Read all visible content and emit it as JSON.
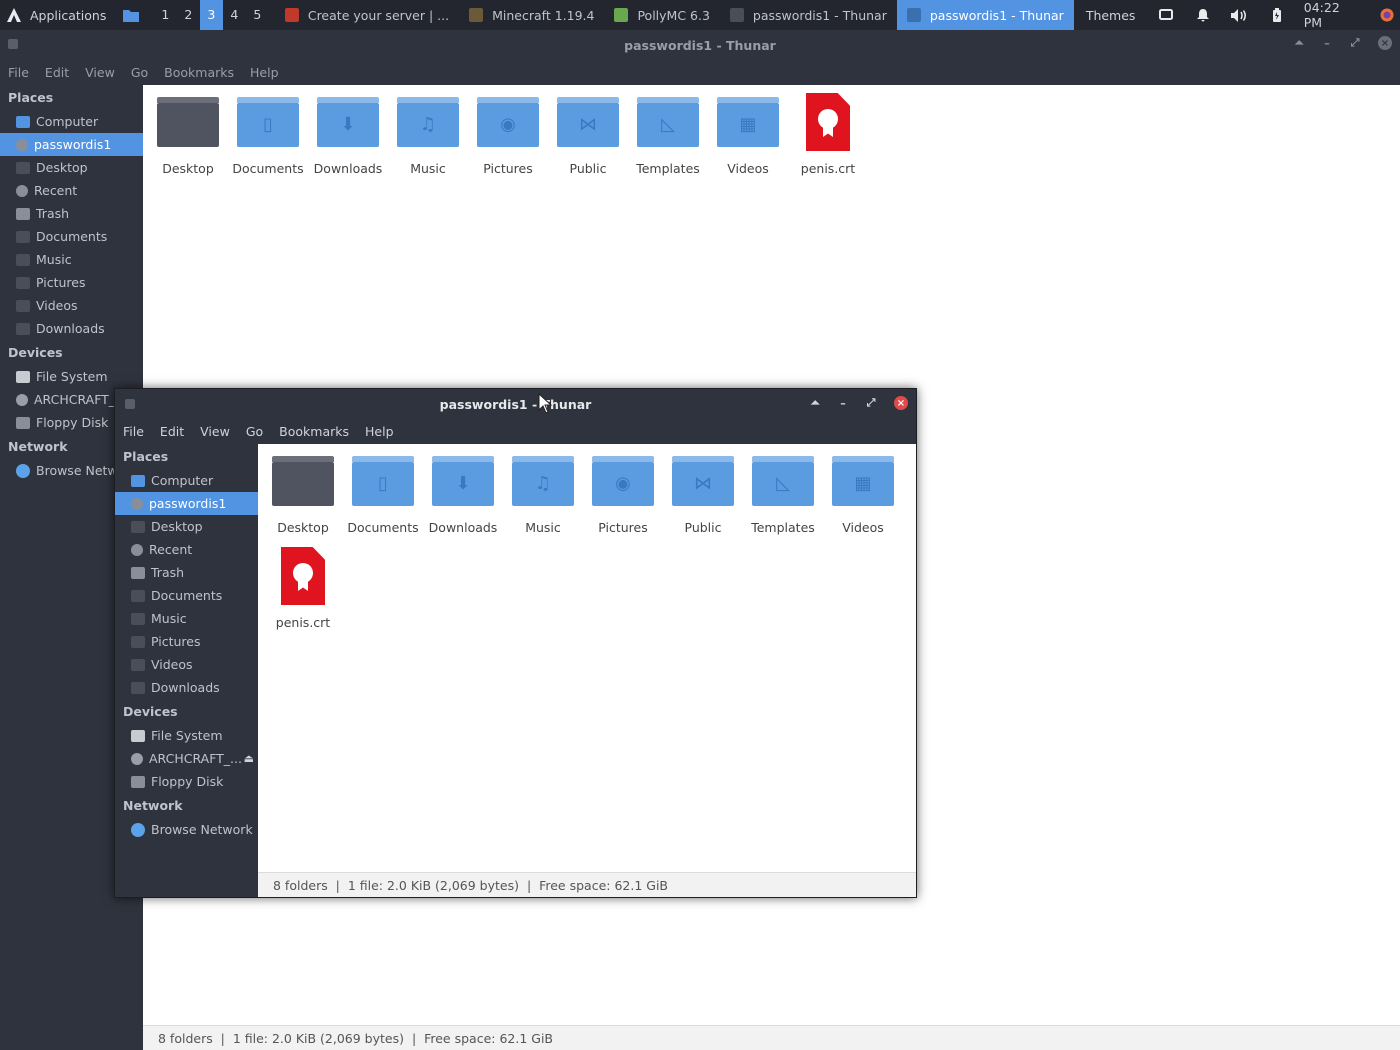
{
  "panel": {
    "app_menu_label": "Applications",
    "workspaces": [
      "1",
      "2",
      "3",
      "4",
      "5"
    ],
    "active_workspace": "3",
    "tasks": [
      {
        "label": "Create your server | ...",
        "icon": "browser-icon",
        "color": "#c0392b",
        "active": false
      },
      {
        "label": "Minecraft 1.19.4",
        "icon": "minecraft-icon",
        "color": "#6b5a3a",
        "active": false
      },
      {
        "label": "PollyMC 6.3",
        "icon": "pollymc-icon",
        "color": "#6aa84f",
        "active": false
      },
      {
        "label": "passwordis1 - Thunar",
        "icon": "thunar-icon",
        "color": "#4a4e58",
        "active": false
      },
      {
        "label": "passwordis1 - Thunar",
        "icon": "thunar-icon",
        "color": "#3a6fb0",
        "active": true
      }
    ],
    "themes_label": "Themes",
    "clock": "04:22 PM"
  },
  "window": {
    "title": "passwordis1 - Thunar",
    "menu": [
      "File",
      "Edit",
      "View",
      "Go",
      "Bookmarks",
      "Help"
    ]
  },
  "sidebar": {
    "places_header": "Places",
    "places": [
      {
        "label": "Computer",
        "icon": "computer-icon",
        "selected": false
      },
      {
        "label": "passwordis1",
        "icon": "home-icon",
        "selected": true
      },
      {
        "label": "Desktop",
        "icon": "desktop-icon",
        "selected": false
      },
      {
        "label": "Recent",
        "icon": "recent-icon",
        "selected": false
      },
      {
        "label": "Trash",
        "icon": "trash-icon",
        "selected": false
      },
      {
        "label": "Documents",
        "icon": "documents-icon",
        "selected": false
      },
      {
        "label": "Music",
        "icon": "music-icon",
        "selected": false
      },
      {
        "label": "Pictures",
        "icon": "pictures-icon",
        "selected": false
      },
      {
        "label": "Videos",
        "icon": "videos-icon",
        "selected": false
      },
      {
        "label": "Downloads",
        "icon": "downloads-icon",
        "selected": false
      }
    ],
    "devices_header": "Devices",
    "devices_bg": [
      {
        "label": "File System",
        "icon": "drive-icon"
      },
      {
        "label": "ARCHCRAFT_",
        "icon": "disc-icon"
      },
      {
        "label": "Floppy Disk",
        "icon": "floppy-icon"
      }
    ],
    "devices_fg": [
      {
        "label": "File System",
        "icon": "drive-icon"
      },
      {
        "label": "ARCHCRAFT_...",
        "icon": "disc-icon",
        "eject": true
      },
      {
        "label": "Floppy Disk",
        "icon": "floppy-icon"
      }
    ],
    "network_header": "Network",
    "network_bg": [
      {
        "label": "Browse Netwo",
        "icon": "network-icon"
      }
    ],
    "network_fg": [
      {
        "label": "Browse Network",
        "icon": "network-icon"
      }
    ]
  },
  "files": [
    {
      "name": "Desktop",
      "kind": "desktop",
      "glyph": ""
    },
    {
      "name": "Documents",
      "kind": "folder",
      "glyph": "▯"
    },
    {
      "name": "Downloads",
      "kind": "folder",
      "glyph": "⬇"
    },
    {
      "name": "Music",
      "kind": "folder",
      "glyph": "♫"
    },
    {
      "name": "Pictures",
      "kind": "folder",
      "glyph": "◉"
    },
    {
      "name": "Public",
      "kind": "folder",
      "glyph": "⋈"
    },
    {
      "name": "Templates",
      "kind": "folder",
      "glyph": "◺"
    },
    {
      "name": "Videos",
      "kind": "folder",
      "glyph": "▦"
    },
    {
      "name": "penis.crt",
      "kind": "certificate",
      "glyph": ""
    }
  ],
  "status": "8 folders  |  1 file: 2.0 KiB (2,069 bytes)  |  Free space: 62.1 GiB"
}
